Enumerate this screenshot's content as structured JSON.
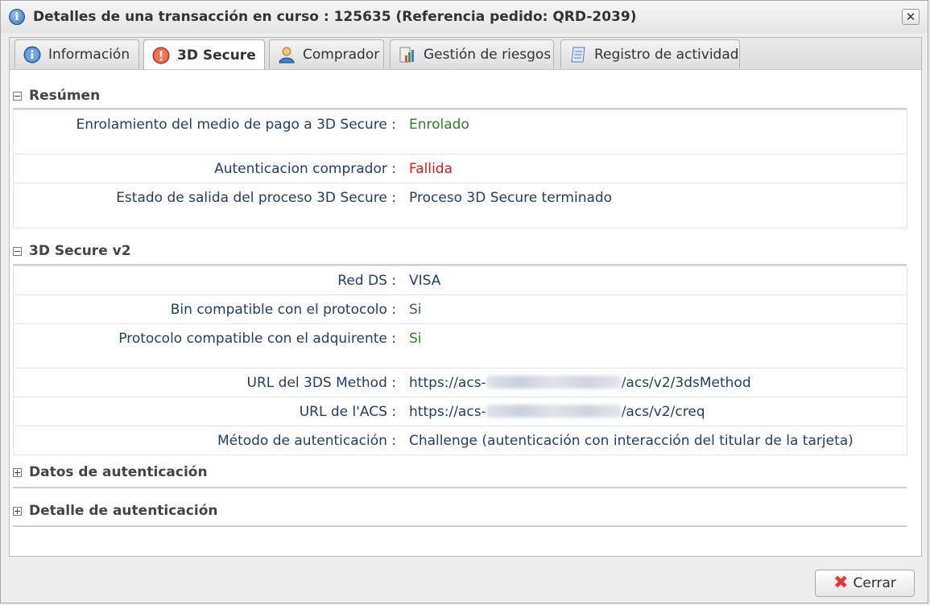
{
  "window": {
    "title": "Detalles de una transacción en curso : 125635 (Referencia pedido: QRD-2039)",
    "close_glyph": "✕"
  },
  "tabs": [
    {
      "label": "Información",
      "icon": "info-icon",
      "active": false
    },
    {
      "label": "3D Secure",
      "icon": "alert-icon",
      "active": true
    },
    {
      "label": "Comprador",
      "icon": "user-icon",
      "active": false
    },
    {
      "label": "Gestión de riesgos",
      "icon": "chart-icon",
      "active": false
    },
    {
      "label": "Registro de actividad",
      "icon": "document-icon",
      "active": false
    }
  ],
  "sections": {
    "resumen": {
      "title": "Resúmen",
      "rows": [
        {
          "label": "Enrolamiento del medio de pago a 3D Secure :",
          "value": "Enrolado"
        },
        {
          "label": "Autenticacion comprador :",
          "value": "Fallida"
        },
        {
          "label": "Estado de salida del proceso 3D Secure :",
          "value": "Proceso 3D Secure terminado"
        }
      ]
    },
    "v2": {
      "title": "3D Secure v2",
      "rows": [
        {
          "label": "Red DS :",
          "value": "VISA"
        },
        {
          "label": "Bin compatible con el protocolo :",
          "value": "Si"
        },
        {
          "label": "Protocolo compatible con el adquirente :",
          "value": "Si"
        },
        {
          "label": "URL del 3DS Method :",
          "value_prefix": "https://acs-",
          "value_suffix": "/acs/v2/3dsMethod"
        },
        {
          "label": "URL de l'ACS :",
          "value_prefix": "https://acs-",
          "value_suffix": "/acs/v2/creq"
        },
        {
          "label": "Método de autenticación :",
          "value": "Challenge (autenticación con interacción del titular de la tarjeta)"
        }
      ]
    },
    "datos": {
      "title": "Datos de autenticación"
    },
    "detalle": {
      "title": "Detalle de autenticación"
    }
  },
  "footer": {
    "close_label": "Cerrar",
    "close_glyph": "✖"
  },
  "colors": {
    "positive": "#2a7f1e",
    "negative": "#e01818",
    "label": "#1f3e6b"
  }
}
